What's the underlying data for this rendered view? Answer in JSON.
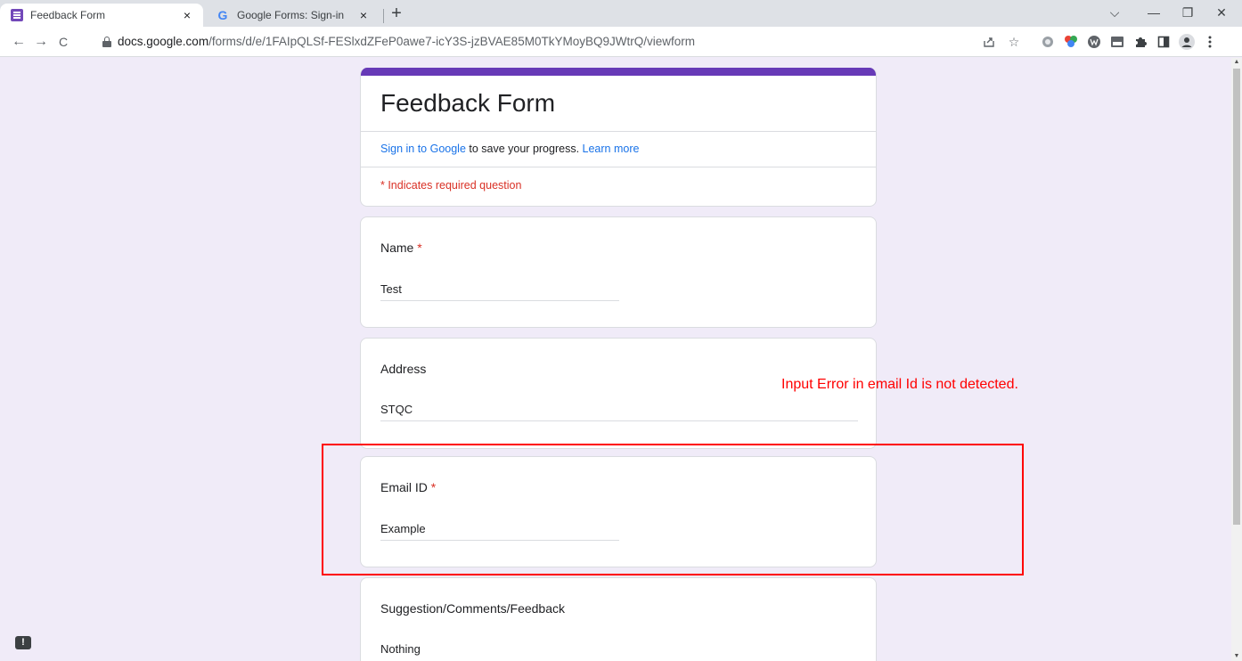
{
  "browser": {
    "tabs": [
      {
        "title": "Feedback Form",
        "close": "×"
      },
      {
        "title": "Google Forms: Sign-in",
        "close": "×",
        "favicon": "G"
      }
    ],
    "new_tab": "+",
    "window_controls": {
      "dropdown": "⌵",
      "minimize": "—",
      "restore": "❐",
      "close": "✕"
    },
    "nav": {
      "back": "←",
      "forward": "→",
      "reload": "C"
    },
    "url_host": "docs.google.com",
    "url_path": "/forms/d/e/1FAIpQLSf-FESlxdZFeP0awe7-icY3S-jzBVAE85M0TkYMoyBQ9JWtrQ/viewform",
    "toolbar_icons": [
      "share-icon",
      "star-icon",
      "extension-icon",
      "color-extension-icon",
      "w-extension-icon",
      "new-extension-icon",
      "puzzle-icon",
      "side-panel-icon",
      "profile-icon",
      "menu-icon"
    ]
  },
  "form": {
    "title": "Feedback Form",
    "signin_link": "Sign in to Google",
    "signin_text": " to save your progress. ",
    "learn_more": "Learn more",
    "required_note": "* Indicates required question",
    "questions": [
      {
        "label": "Name",
        "required": "*",
        "value": "Test"
      },
      {
        "label": "Address",
        "value": "STQC"
      },
      {
        "label": "Email ID",
        "required": "*",
        "value": "Example"
      },
      {
        "label": "Suggestion/Comments/Feedback",
        "value": "Nothing"
      }
    ]
  },
  "annotation": {
    "text": "Input Error in email Id is not detected.",
    "color": "#ff0000"
  },
  "colors": {
    "accent": "#673ab7",
    "background": "#f0ebf8",
    "link": "#1a73e8",
    "required": "#d93025"
  }
}
